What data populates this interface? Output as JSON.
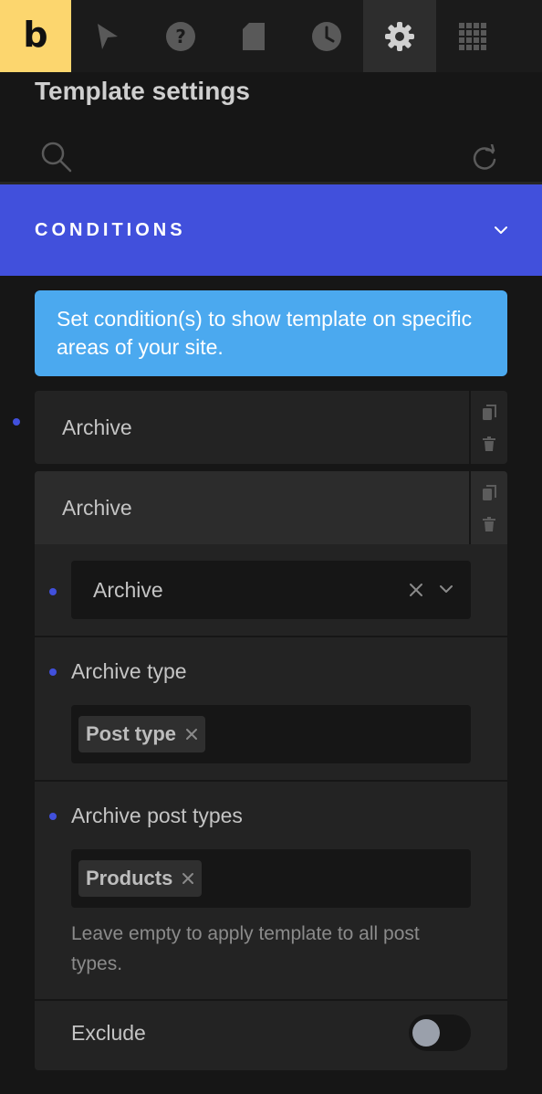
{
  "toolbar": {
    "logo_letter": "b",
    "items": [
      {
        "icon": "logo",
        "label": "b"
      },
      {
        "icon": "cursor-icon"
      },
      {
        "icon": "help-icon"
      },
      {
        "icon": "page-icon"
      },
      {
        "icon": "history-icon"
      },
      {
        "icon": "gear-icon",
        "active": true
      },
      {
        "icon": "grid-icon"
      },
      {
        "icon": "circle-icon"
      }
    ]
  },
  "panel": {
    "title": "Template settings",
    "search_icon": "search-icon",
    "refresh_icon": "refresh-icon"
  },
  "conditions": {
    "title": "CONDITIONS",
    "info": "Set condition(s) to show template on specific areas of your site.",
    "items": [
      {
        "label": "Archive"
      },
      {
        "label": "Archive",
        "expanded": true
      }
    ],
    "detail": {
      "main_select": "Archive",
      "archive_type_label": "Archive type",
      "archive_type_tag": "Post type",
      "post_types_label": "Archive post types",
      "post_types_tag": "Products",
      "post_types_help": "Leave empty to apply template to all post types.",
      "exclude_label": "Exclude",
      "exclude_on": false
    }
  },
  "colors": {
    "accent": "#4150dc",
    "info": "#4ba9ef",
    "logo_bg": "#fcd66e",
    "background": "#161616"
  }
}
